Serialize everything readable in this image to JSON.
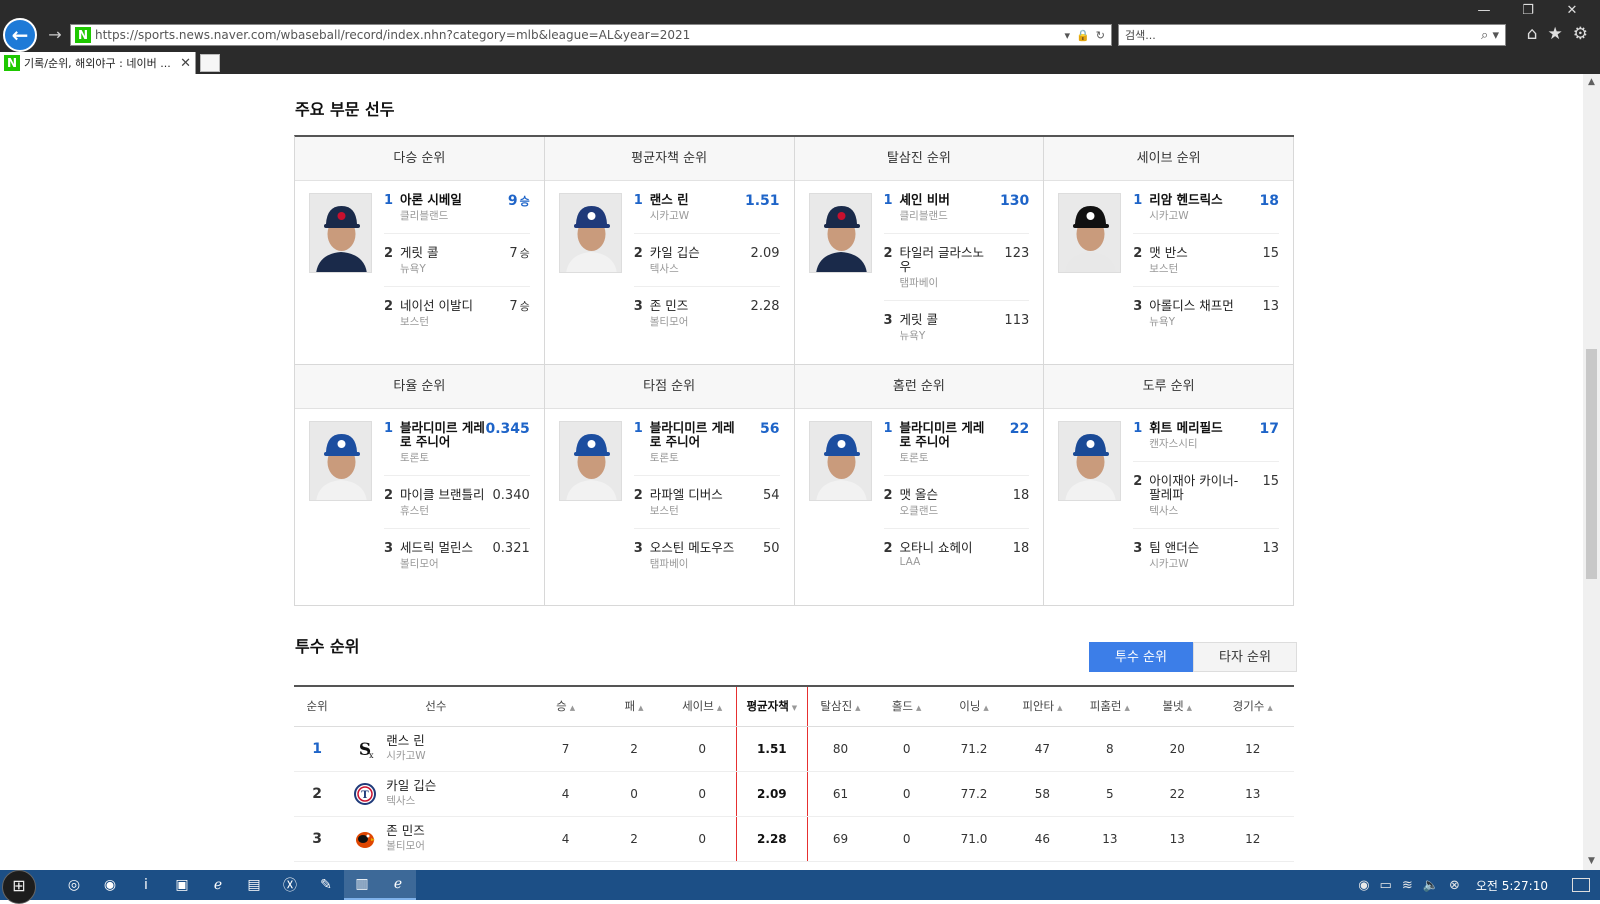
{
  "browser": {
    "url": "https://sports.news.naver.com/wbaseball/record/index.nhn?category=mlb&league=AL&year=2021",
    "search_placeholder": "검색...",
    "tab_title": "기록/순위, 해외야구 : 네이버 ...",
    "favicon_letter": "N",
    "back_icon": "back-arrow-icon",
    "forward_icon": "forward-arrow-icon"
  },
  "leaders": {
    "title": "주요 부문 선두",
    "cards": [
      {
        "heading": "다승 순위",
        "unit": "승",
        "photo_cap": "indians",
        "entries": [
          {
            "rank": "1",
            "name": "아론 시베일",
            "team": "클리블랜드",
            "value": "9"
          },
          {
            "rank": "2",
            "name": "게릿 콜",
            "team": "뉴욕Y",
            "value": "7"
          },
          {
            "rank": "2",
            "name": "네이선 이발디",
            "team": "보스턴",
            "value": "7"
          }
        ]
      },
      {
        "heading": "평균자책 순위",
        "unit": "",
        "photo_cap": "rangers",
        "entries": [
          {
            "rank": "1",
            "name": "랜스 린",
            "team": "시카고W",
            "value": "1.51"
          },
          {
            "rank": "2",
            "name": "카일 깁슨",
            "team": "텍사스",
            "value": "2.09"
          },
          {
            "rank": "3",
            "name": "존 민즈",
            "team": "볼티모어",
            "value": "2.28"
          }
        ]
      },
      {
        "heading": "탈삼진 순위",
        "unit": "",
        "photo_cap": "indians",
        "entries": [
          {
            "rank": "1",
            "name": "셰인 비버",
            "team": "클리블랜드",
            "value": "130"
          },
          {
            "rank": "2",
            "name": "타일러 글라스노우",
            "team": "탬파베이",
            "value": "123"
          },
          {
            "rank": "3",
            "name": "게릿 콜",
            "team": "뉴욕Y",
            "value": "113"
          }
        ]
      },
      {
        "heading": "세이브 순위",
        "unit": "",
        "photo_cap": "whitesox",
        "entries": [
          {
            "rank": "1",
            "name": "리암 헨드릭스",
            "team": "시카고W",
            "value": "18"
          },
          {
            "rank": "2",
            "name": "맷 반스",
            "team": "보스턴",
            "value": "15"
          },
          {
            "rank": "3",
            "name": "아롤디스 채프먼",
            "team": "뉴욕Y",
            "value": "13"
          }
        ]
      },
      {
        "heading": "타율 순위",
        "unit": "",
        "photo_cap": "bluejays",
        "entries": [
          {
            "rank": "1",
            "name": "블라디미르 게레로 주니어",
            "team": "토론토",
            "value": "0.345"
          },
          {
            "rank": "2",
            "name": "마이클 브랜틀리",
            "team": "휴스턴",
            "value": "0.340"
          },
          {
            "rank": "3",
            "name": "세드릭 멀린스",
            "team": "볼티모어",
            "value": "0.321"
          }
        ]
      },
      {
        "heading": "타점 순위",
        "unit": "",
        "photo_cap": "bluejays",
        "entries": [
          {
            "rank": "1",
            "name": "블라디미르 게레로 주니어",
            "team": "토론토",
            "value": "56"
          },
          {
            "rank": "2",
            "name": "라파엘 디버스",
            "team": "보스턴",
            "value": "54"
          },
          {
            "rank": "3",
            "name": "오스틴 메도우즈",
            "team": "탬파베이",
            "value": "50"
          }
        ]
      },
      {
        "heading": "홈런 순위",
        "unit": "",
        "photo_cap": "bluejays",
        "entries": [
          {
            "rank": "1",
            "name": "블라디미르 게레로 주니어",
            "team": "토론토",
            "value": "22"
          },
          {
            "rank": "2",
            "name": "맷 올슨",
            "team": "오클랜드",
            "value": "18"
          },
          {
            "rank": "2",
            "name": "오타니 쇼헤이",
            "team": "LAA",
            "value": "18"
          }
        ]
      },
      {
        "heading": "도루 순위",
        "unit": "",
        "photo_cap": "royals",
        "entries": [
          {
            "rank": "1",
            "name": "휘트 메리필드",
            "team": "캔자스시티",
            "value": "17"
          },
          {
            "rank": "2",
            "name": "아이재아 카이너-팔레파",
            "team": "텍사스",
            "value": "15"
          },
          {
            "rank": "3",
            "name": "팀 앤더슨",
            "team": "시카고W",
            "value": "13"
          }
        ]
      }
    ]
  },
  "pitching": {
    "title": "투수 순위",
    "toggle": {
      "pitcher_label": "투수 순위",
      "batter_label": "타자 순위",
      "active": "pitcher"
    },
    "columns": [
      "순위",
      "선수",
      "승",
      "패",
      "세이브",
      "평균자책",
      "탈삼진",
      "홀드",
      "이닝",
      "피안타",
      "피홈런",
      "볼넷",
      "경기수"
    ],
    "sorted_column": "평균자책",
    "rows": [
      {
        "rank": "1",
        "name": "랜스 린",
        "team": "시카고W",
        "logo": "whitesox-logo-icon",
        "stats": [
          "7",
          "2",
          "0",
          "1.51",
          "80",
          "0",
          "71.2",
          "47",
          "8",
          "20",
          "12"
        ]
      },
      {
        "rank": "2",
        "name": "카일 깁슨",
        "team": "텍사스",
        "logo": "rangers-logo-icon",
        "stats": [
          "4",
          "0",
          "0",
          "2.09",
          "61",
          "0",
          "77.2",
          "58",
          "5",
          "22",
          "13"
        ]
      },
      {
        "rank": "3",
        "name": "존 민즈",
        "team": "볼티모어",
        "logo": "orioles-logo-icon",
        "stats": [
          "4",
          "2",
          "0",
          "2.28",
          "69",
          "0",
          "71.0",
          "46",
          "13",
          "13",
          "12"
        ]
      }
    ]
  },
  "taskbar": {
    "clock": "오전 5:27:10",
    "apps": [
      "chrome-icon",
      "network-globe-icon",
      "app-i-icon",
      "media-icon",
      "ie-icon",
      "explorer-icon",
      "excel-icon",
      "paint-icon",
      "notepad-icon",
      "ie-active-icon"
    ]
  }
}
